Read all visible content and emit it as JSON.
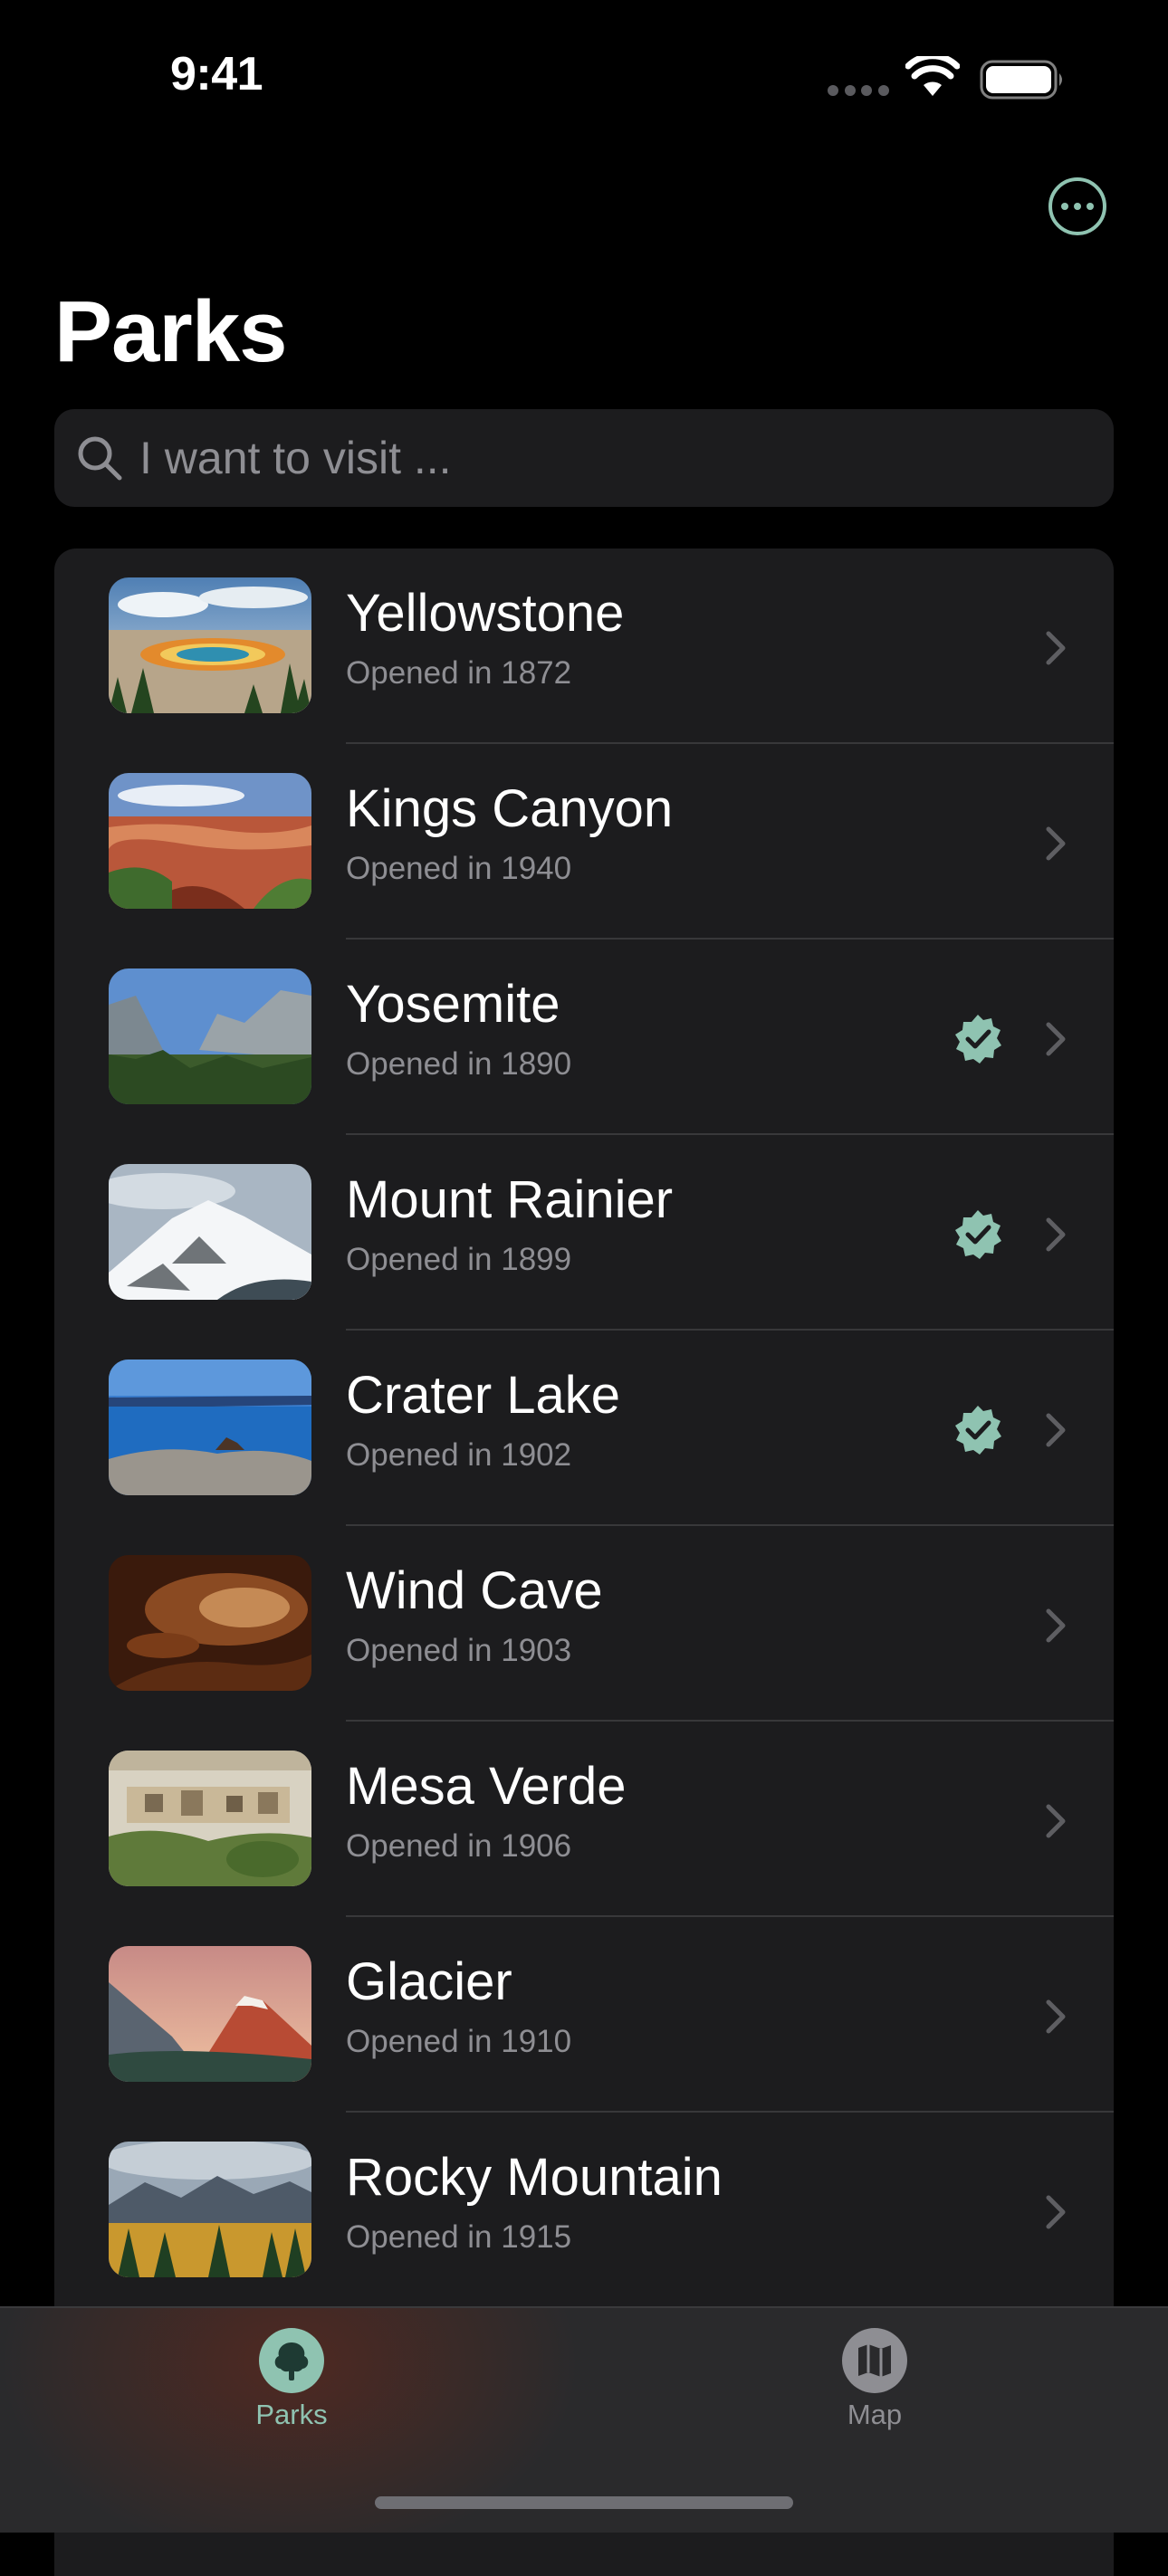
{
  "status_bar": {
    "time": "9:41"
  },
  "header": {
    "title": "Parks",
    "more_icon": "ellipsis-circle-icon"
  },
  "search": {
    "placeholder": "I want to visit ...",
    "value": ""
  },
  "colors": {
    "accent": "#8fc3b1",
    "background": "#000000",
    "list_background": "#1c1c1e",
    "secondary_text": "#8e8e93"
  },
  "parks": [
    {
      "name": "Yellowstone",
      "opened": "Opened in 1872",
      "visited": false
    },
    {
      "name": "Kings Canyon",
      "opened": "Opened in 1940",
      "visited": false
    },
    {
      "name": "Yosemite",
      "opened": "Opened in 1890",
      "visited": true
    },
    {
      "name": "Mount Rainier",
      "opened": "Opened in 1899",
      "visited": true
    },
    {
      "name": "Crater Lake",
      "opened": "Opened in 1902",
      "visited": true
    },
    {
      "name": "Wind Cave",
      "opened": "Opened in 1903",
      "visited": false
    },
    {
      "name": "Mesa Verde",
      "opened": "Opened in 1906",
      "visited": false
    },
    {
      "name": "Glacier",
      "opened": "Opened in 1910",
      "visited": false
    },
    {
      "name": "Rocky Mountain",
      "opened": "Opened in 1915",
      "visited": false
    }
  ],
  "tab_bar": {
    "tabs": [
      {
        "label": "Parks",
        "icon": "tree-icon",
        "selected": true
      },
      {
        "label": "Map",
        "icon": "map-icon",
        "selected": false
      }
    ]
  }
}
